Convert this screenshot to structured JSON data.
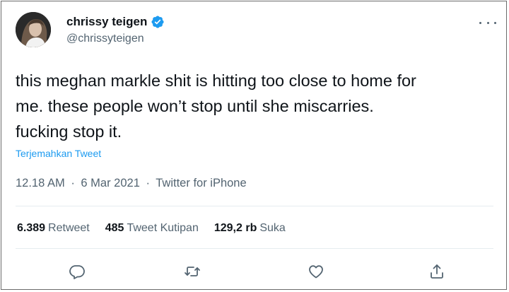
{
  "author": {
    "display_name": "chrissy teigen",
    "handle": "@chrissyteigen",
    "verified": true,
    "verified_color": "#1d9bf0"
  },
  "tweet": {
    "lines": [
      "this meghan markle shit is hitting too close to home for",
      "me. these people won’t stop until she miscarries.",
      "fucking stop it."
    ],
    "translate_label": "Terjemahkan Tweet",
    "time": "12.18 AM",
    "date": "6 Mar 2021",
    "source": "Twitter for iPhone",
    "separator": "·"
  },
  "stats": {
    "retweets": {
      "count": "6.389",
      "label": "Retweet"
    },
    "quotes": {
      "count": "485",
      "label": "Tweet Kutipan"
    },
    "likes": {
      "count": "129,2 rb",
      "label": "Suka"
    }
  },
  "actions": [
    "reply-icon",
    "retweet-icon",
    "like-icon",
    "share-icon"
  ],
  "colors": {
    "text": "#0f1419",
    "secondary": "#536471",
    "link": "#1d9bf0",
    "divider": "#e6ecf0"
  }
}
